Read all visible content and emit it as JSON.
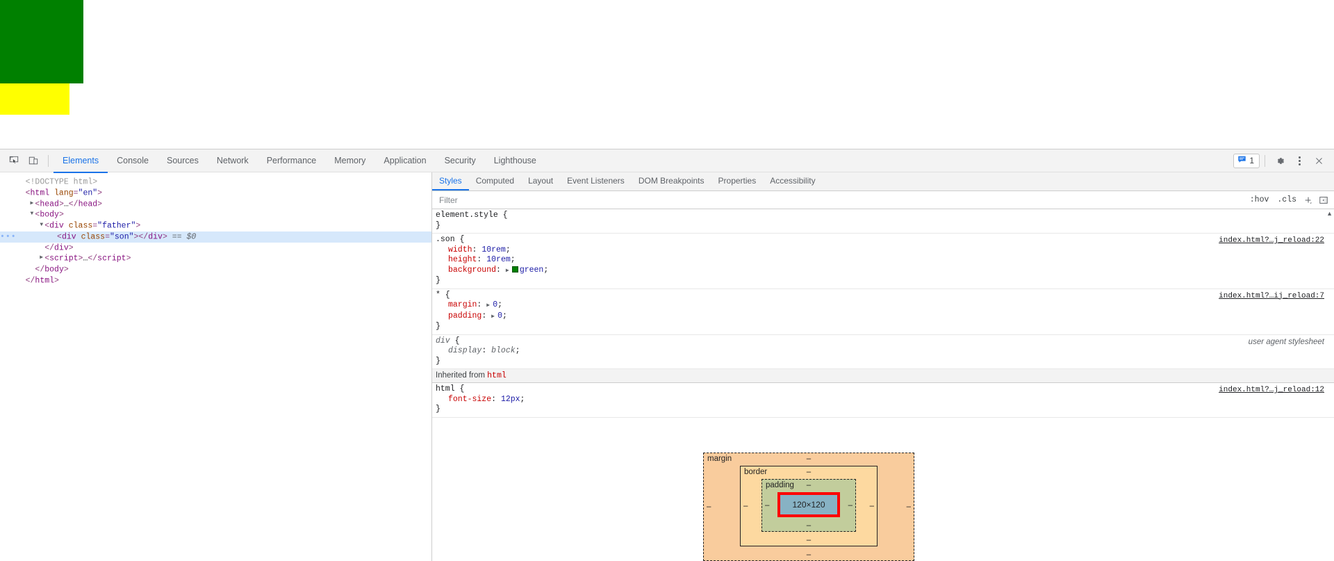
{
  "viewport": {
    "green_box_color": "#008000",
    "yellow_box_color": "#ffff00"
  },
  "devtools": {
    "toolbar": {
      "inspect_icon": "inspect-element-icon",
      "device_icon": "device-toolbar-icon",
      "tabs": [
        {
          "label": "Elements",
          "active": true
        },
        {
          "label": "Console",
          "active": false
        },
        {
          "label": "Sources",
          "active": false
        },
        {
          "label": "Network",
          "active": false
        },
        {
          "label": "Performance",
          "active": false
        },
        {
          "label": "Memory",
          "active": false
        },
        {
          "label": "Application",
          "active": false
        },
        {
          "label": "Security",
          "active": false
        },
        {
          "label": "Lighthouse",
          "active": false
        }
      ],
      "message_count": "1",
      "settings_icon": "gear-icon",
      "more_icon": "kebab-menu-icon",
      "close_icon": "close-icon"
    },
    "dom_tree": [
      {
        "indent": 0,
        "twisty": "none",
        "selected": false,
        "parts": [
          {
            "t": "cmtdoc",
            "v": "<!DOCTYPE html>"
          }
        ]
      },
      {
        "indent": 0,
        "twisty": "none",
        "selected": false,
        "parts": [
          {
            "t": "punct",
            "v": "<"
          },
          {
            "t": "tag",
            "v": "html"
          },
          {
            "t": "plain",
            "v": " "
          },
          {
            "t": "attr",
            "v": "lang"
          },
          {
            "t": "punct",
            "v": "="
          },
          {
            "t": "val",
            "v": "\"en\""
          },
          {
            "t": "punct",
            "v": ">"
          }
        ]
      },
      {
        "indent": 1,
        "twisty": "closed",
        "selected": false,
        "parts": [
          {
            "t": "punct",
            "v": "<"
          },
          {
            "t": "tag",
            "v": "head"
          },
          {
            "t": "punct",
            "v": ">"
          },
          {
            "t": "plain",
            "v": "…"
          },
          {
            "t": "punct",
            "v": "</"
          },
          {
            "t": "tag",
            "v": "head"
          },
          {
            "t": "punct",
            "v": ">"
          }
        ]
      },
      {
        "indent": 1,
        "twisty": "open",
        "selected": false,
        "parts": [
          {
            "t": "punct",
            "v": "<"
          },
          {
            "t": "tag",
            "v": "body"
          },
          {
            "t": "punct",
            "v": ">"
          }
        ]
      },
      {
        "indent": 2,
        "twisty": "open",
        "selected": false,
        "parts": [
          {
            "t": "punct",
            "v": "<"
          },
          {
            "t": "tag",
            "v": "div"
          },
          {
            "t": "plain",
            "v": " "
          },
          {
            "t": "attr",
            "v": "class"
          },
          {
            "t": "punct",
            "v": "="
          },
          {
            "t": "val",
            "v": "\"father\""
          },
          {
            "t": "punct",
            "v": ">"
          }
        ]
      },
      {
        "indent": 3,
        "twisty": "none",
        "selected": true,
        "dots": true,
        "parts": [
          {
            "t": "punct",
            "v": "<"
          },
          {
            "t": "tag",
            "v": "div"
          },
          {
            "t": "plain",
            "v": " "
          },
          {
            "t": "attr",
            "v": "class"
          },
          {
            "t": "punct",
            "v": "="
          },
          {
            "t": "val",
            "v": "\"son\""
          },
          {
            "t": "punct",
            "v": "></"
          },
          {
            "t": "tag",
            "v": "div"
          },
          {
            "t": "punct",
            "v": ">"
          },
          {
            "t": "marker",
            "v": " == $0"
          }
        ]
      },
      {
        "indent": 2,
        "twisty": "none",
        "selected": false,
        "parts": [
          {
            "t": "punct",
            "v": "</"
          },
          {
            "t": "tag",
            "v": "div"
          },
          {
            "t": "punct",
            "v": ">"
          }
        ]
      },
      {
        "indent": 2,
        "twisty": "closed",
        "selected": false,
        "parts": [
          {
            "t": "punct",
            "v": "<"
          },
          {
            "t": "tag",
            "v": "script"
          },
          {
            "t": "punct",
            "v": ">"
          },
          {
            "t": "plain",
            "v": "…"
          },
          {
            "t": "punct",
            "v": "</"
          },
          {
            "t": "tag",
            "v": "script"
          },
          {
            "t": "punct",
            "v": ">"
          }
        ]
      },
      {
        "indent": 1,
        "twisty": "none",
        "selected": false,
        "parts": [
          {
            "t": "punct",
            "v": "</"
          },
          {
            "t": "tag",
            "v": "body"
          },
          {
            "t": "punct",
            "v": ">"
          }
        ]
      },
      {
        "indent": 0,
        "twisty": "none",
        "selected": false,
        "parts": [
          {
            "t": "punct",
            "v": "</"
          },
          {
            "t": "tag",
            "v": "html"
          },
          {
            "t": "punct",
            "v": ">"
          }
        ]
      }
    ],
    "styles": {
      "tabs": [
        {
          "label": "Styles",
          "active": true
        },
        {
          "label": "Computed",
          "active": false
        },
        {
          "label": "Layout",
          "active": false
        },
        {
          "label": "Event Listeners",
          "active": false
        },
        {
          "label": "DOM Breakpoints",
          "active": false
        },
        {
          "label": "Properties",
          "active": false
        },
        {
          "label": "Accessibility",
          "active": false
        }
      ],
      "filter_placeholder": "Filter",
      "filter_value": "",
      "hov_label": ":hov",
      "cls_label": ".cls",
      "new_rule_label": "+",
      "toggle_sidebar_icon": "toggle-sidebar-icon",
      "rules": [
        {
          "selector": "element.style",
          "source": "",
          "source_type": "none",
          "declarations": []
        },
        {
          "selector": ".son",
          "source": "index.html?…j_reload:22",
          "source_type": "link",
          "declarations": [
            {
              "prop": "width",
              "value": "10rem",
              "expand": false,
              "swatch": null
            },
            {
              "prop": "height",
              "value": "10rem",
              "expand": false,
              "swatch": null
            },
            {
              "prop": "background",
              "value": "green",
              "expand": true,
              "swatch": "#008000"
            }
          ]
        },
        {
          "selector": "*",
          "source": "index.html?…ij_reload:7",
          "source_type": "link",
          "declarations": [
            {
              "prop": "margin",
              "value": "0",
              "expand": true,
              "swatch": null
            },
            {
              "prop": "padding",
              "value": "0",
              "expand": true,
              "swatch": null
            }
          ]
        },
        {
          "selector": "div",
          "source": "user agent stylesheet",
          "source_type": "ua",
          "ua": true,
          "declarations": [
            {
              "prop": "display",
              "value": "block",
              "expand": false,
              "swatch": null
            }
          ]
        }
      ],
      "inherited_label": "Inherited from",
      "inherited_from": "html",
      "inherited_rules": [
        {
          "selector": "html",
          "source": "index.html?…j_reload:12",
          "source_type": "link",
          "declarations": [
            {
              "prop": "font-size",
              "value": "12px",
              "expand": false,
              "swatch": null
            }
          ]
        }
      ]
    },
    "box_model": {
      "margin_label": "margin",
      "border_label": "border",
      "padding_label": "padding",
      "content_size": "120×120",
      "margin_top": "–",
      "margin_right": "–",
      "margin_bottom": "–",
      "margin_left": "–",
      "border_top": "–",
      "border_right": "–",
      "border_bottom": "–",
      "border_left": "–",
      "padding_top": "–",
      "padding_right": "–",
      "padding_bottom": "–",
      "padding_left": "–",
      "colors": {
        "margin": "#f9cc9d",
        "border": "#fdd9a0",
        "padding": "#c2cd9c",
        "content": "#87b2c4",
        "highlight": "#ff0000"
      }
    }
  }
}
